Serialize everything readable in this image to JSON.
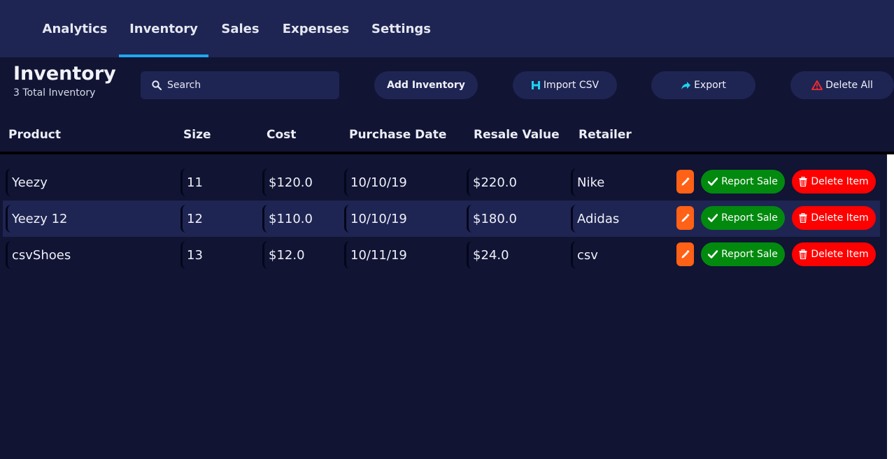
{
  "nav": {
    "tabs": [
      {
        "label": "Analytics"
      },
      {
        "label": "Inventory"
      },
      {
        "label": "Sales"
      },
      {
        "label": "Expenses"
      },
      {
        "label": "Settings"
      }
    ],
    "active_tab": "Inventory"
  },
  "header": {
    "title": "Inventory",
    "subtitle": "3 Total Inventory",
    "search_placeholder": "Search",
    "add_label": "Add Inventory",
    "import_label": "Import CSV",
    "export_label": "Export",
    "delete_all_label": "Delete All"
  },
  "table": {
    "columns": [
      "Product",
      "Size",
      "Cost",
      "Purchase Date",
      "Resale Value",
      "Retailer"
    ],
    "rows": [
      {
        "product": "Yeezy",
        "size": "11",
        "cost": "$120.0",
        "date": "10/10/19",
        "resale": "$220.0",
        "retailer": "Nike"
      },
      {
        "product": "Yeezy 12",
        "size": "12",
        "cost": "$110.0",
        "date": "10/10/19",
        "resale": "$180.0",
        "retailer": "Adidas"
      },
      {
        "product": "csvShoes",
        "size": "13",
        "cost": "$12.0",
        "date": "10/11/19",
        "resale": "$24.0",
        "retailer": "csv"
      }
    ],
    "report_label": "Report Sale",
    "delete_label": "Delete Item"
  },
  "colors": {
    "nav_bg": "#1e2553",
    "page_bg": "#111433",
    "active_underline": "#1fa8ee",
    "edit": "#ff6116",
    "report": "#028a0f",
    "delete": "#ff0000"
  },
  "icons": {
    "search": "search-icon",
    "import": "csv-import-icon",
    "export": "share-arrow-icon",
    "delete_all": "warning-triangle-icon",
    "edit": "pencil-icon",
    "report": "checkmark-icon",
    "delete": "trash-icon"
  }
}
